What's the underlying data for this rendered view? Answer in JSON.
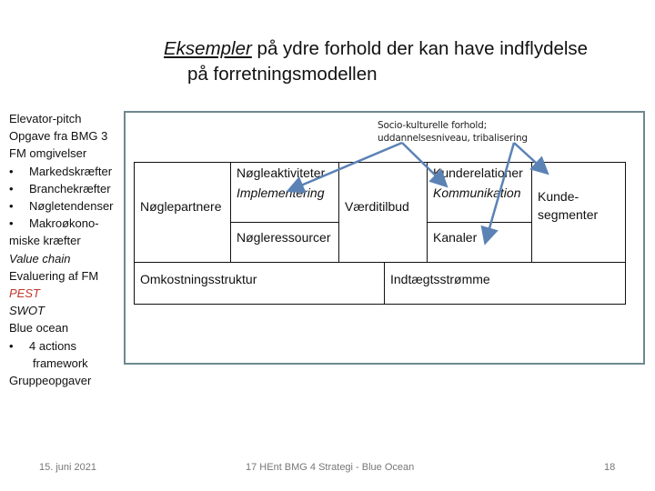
{
  "slide": {
    "title": {
      "emphasis": "Eksempler",
      "rest_line1": " på ydre forhold der kan have indflydelse",
      "line2": "på forretningsmodellen"
    },
    "agenda": {
      "items": [
        {
          "text": "Elevator-pitch",
          "style": "plain"
        },
        {
          "text": "Opgave fra BMG 3",
          "style": "plain"
        },
        {
          "text": "FM omgivelser",
          "style": "plain"
        },
        {
          "text": "Markedskræfter",
          "style": "bullet"
        },
        {
          "text": "Branchekræfter",
          "style": "bullet"
        },
        {
          "text": "Nøgletendenser",
          "style": "bullet"
        },
        {
          "text": "Makroøkono-",
          "style": "bullet"
        },
        {
          "text": "miske kræfter",
          "style": "plain"
        },
        {
          "text": "Value chain",
          "style": "italic"
        },
        {
          "text": "Evaluering af FM",
          "style": "plain"
        },
        {
          "text": "PEST",
          "style": "italic-red"
        },
        {
          "text": "SWOT",
          "style": "italic"
        },
        {
          "text": "Blue ocean",
          "style": "plain"
        },
        {
          "text": "4 actions",
          "style": "bullet"
        },
        {
          "text": "framework",
          "style": "indent"
        },
        {
          "text": "Gruppeopgaver",
          "style": "plain"
        }
      ]
    },
    "annotation": {
      "line1": "Socio-kulturelle forhold;",
      "line2": "uddannelsesniveau, tribalisering"
    },
    "canvas": {
      "key_partners": "Nøglepartnere",
      "key_activities": "Nøgleaktiviteter",
      "key_activities_example": "Implementering",
      "key_resources": "Nøgleressourcer",
      "value_proposition": "Værditilbud",
      "customer_relationships": "Kunderelationer",
      "customer_relationships_example": "Kommunikation",
      "channels": "Kanaler",
      "customer_segments_line1": "Kunde-",
      "customer_segments_line2": "segmenter",
      "cost_structure": "Omkostningsstruktur",
      "revenue_streams": "Indtægtsstrømme"
    },
    "colors": {
      "arrow": "#5b82b5",
      "frame": "#6e8890",
      "pest": "#c0392b"
    },
    "footer": {
      "date": "15. juni 2021",
      "course": "17 HEnt  BMG 4 Strategi - Blue Ocean",
      "page": "18"
    }
  }
}
